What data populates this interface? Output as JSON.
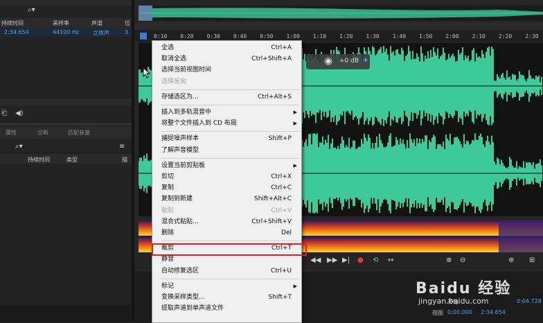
{
  "files_panel": {
    "columns": [
      "持续时间",
      "采样率",
      "声道",
      "位"
    ],
    "row": {
      "duration": "2:34.654",
      "sample_rate": "44100 Hz",
      "channels": "立体声",
      "bits": "3"
    }
  },
  "props_panel": {
    "tabs": [
      "属性",
      "诊断",
      "匹配音量"
    ],
    "columns": [
      "持续时间",
      "类型",
      "描"
    ]
  },
  "timeline": {
    "ticks": [
      "0:10",
      "0:20",
      "0:30",
      "0:40",
      "0:50",
      "1:00",
      "1:10",
      "1:20",
      "1:30",
      "1:40",
      "1:50",
      "2:00",
      "2:10",
      "2:20",
      "2:30"
    ],
    "hud_gain": "+0 dB"
  },
  "context_menu": {
    "items": [
      {
        "label": "全选",
        "shortcut": "Ctrl+A"
      },
      {
        "label": "取消全选",
        "shortcut": "Ctrl+Shift+A"
      },
      {
        "label": "选择当前视图时间",
        "shortcut": ""
      },
      {
        "label": "选择反向",
        "shortcut": "",
        "disabled": true
      },
      {
        "label": "存储选区为...",
        "shortcut": "Ctrl+Alt+S"
      },
      {
        "label": "插入到多轨混音中",
        "shortcut": "",
        "submenu": true
      },
      {
        "label": "将整个文件插入到 CD 布局",
        "shortcut": "",
        "submenu": true
      },
      {
        "label": "捕捉噪声样本",
        "shortcut": "Shift+P"
      },
      {
        "label": "了解声音模型",
        "shortcut": ""
      },
      {
        "label": "设置当前剪贴板",
        "shortcut": "",
        "submenu": true
      },
      {
        "label": "剪切",
        "shortcut": "Ctrl+X"
      },
      {
        "label": "复制",
        "shortcut": "Ctrl+C"
      },
      {
        "label": "复制到新建",
        "shortcut": "Shift+Alt+C"
      },
      {
        "label": "粘贴",
        "shortcut": "Ctrl+V",
        "disabled": true
      },
      {
        "label": "混合式粘贴...",
        "shortcut": "Ctrl+Shift+V"
      },
      {
        "label": "删除",
        "shortcut": "Del"
      },
      {
        "label": "裁剪",
        "shortcut": "Ctrl+T"
      },
      {
        "label": "静音",
        "shortcut": ""
      },
      {
        "label": "自动修复选区",
        "shortcut": "Ctrl+U"
      },
      {
        "label": "标记",
        "shortcut": "",
        "submenu": true
      },
      {
        "label": "变换采样类型...",
        "shortcut": "Shift+T"
      },
      {
        "label": "提取声道到单声道文件",
        "shortcut": ""
      }
    ]
  },
  "selection_info": {
    "labels": [
      "开始",
      "视图"
    ],
    "values": [
      "0:00.000",
      "2:34.654",
      "0:00.000",
      "2:34.654",
      "0:04.728"
    ]
  },
  "watermark": {
    "logo": "Baidu 经验",
    "url": "jingyan.baidu.com"
  },
  "colors": {
    "waveform": "#3ec99a",
    "highlight": "#e02020",
    "selection_blue": "#4aa3ff"
  }
}
